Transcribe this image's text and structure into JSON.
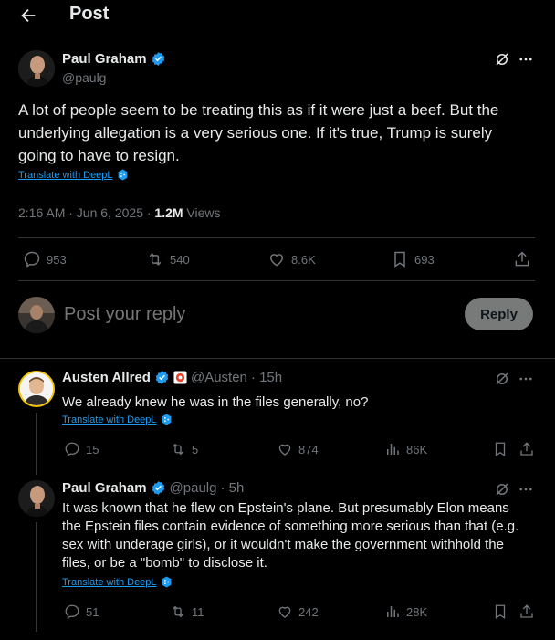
{
  "header": {
    "back_icon": "arrow-left-icon",
    "title": "Post"
  },
  "main_post": {
    "author": "Paul Graham",
    "handle": "@paulg",
    "text": "A lot of people seem to be treating this as if it were just a beef. But the underlying allegation is a very serious one. If it's true, Trump is surely going to have to resign.",
    "translate": "Translate with DeepL",
    "timestamp": "2:16 AM · Jun 6, 2025 · ",
    "views_count": "1.2M",
    "views_label": " Views",
    "stats": {
      "replies": "953",
      "reposts": "540",
      "likes": "8.6K",
      "bookmarks": "693"
    }
  },
  "composer": {
    "placeholder": "Post your reply",
    "reply_label": "Reply"
  },
  "replies": [
    {
      "author": "Austen Allred",
      "handle": "@Austen",
      "time": "· 15h",
      "text": "We already knew he was in the files generally, no?",
      "translate": "Translate with DeepL",
      "stats": {
        "replies": "15",
        "reposts": "5",
        "likes": "874",
        "views": "86K"
      }
    },
    {
      "author": "Paul Graham",
      "handle": "@paulg",
      "time": "· 5h",
      "text": "It was known that he flew on Epstein's plane. But presumably Elon means the Epstein files contain evidence of something more serious than that (e.g. sex with underage girls), or it wouldn't make the government withhold the files, or be a \"bomb\" to disclose it.",
      "translate": "Translate with DeepL",
      "stats": {
        "replies": "51",
        "reposts": "11",
        "likes": "242",
        "views": "28K"
      }
    }
  ],
  "colors": {
    "accent": "#1d9bf0",
    "verified": "#1d9bf0",
    "muted": "#71767b",
    "reply_button_bg": "#787a7a"
  }
}
